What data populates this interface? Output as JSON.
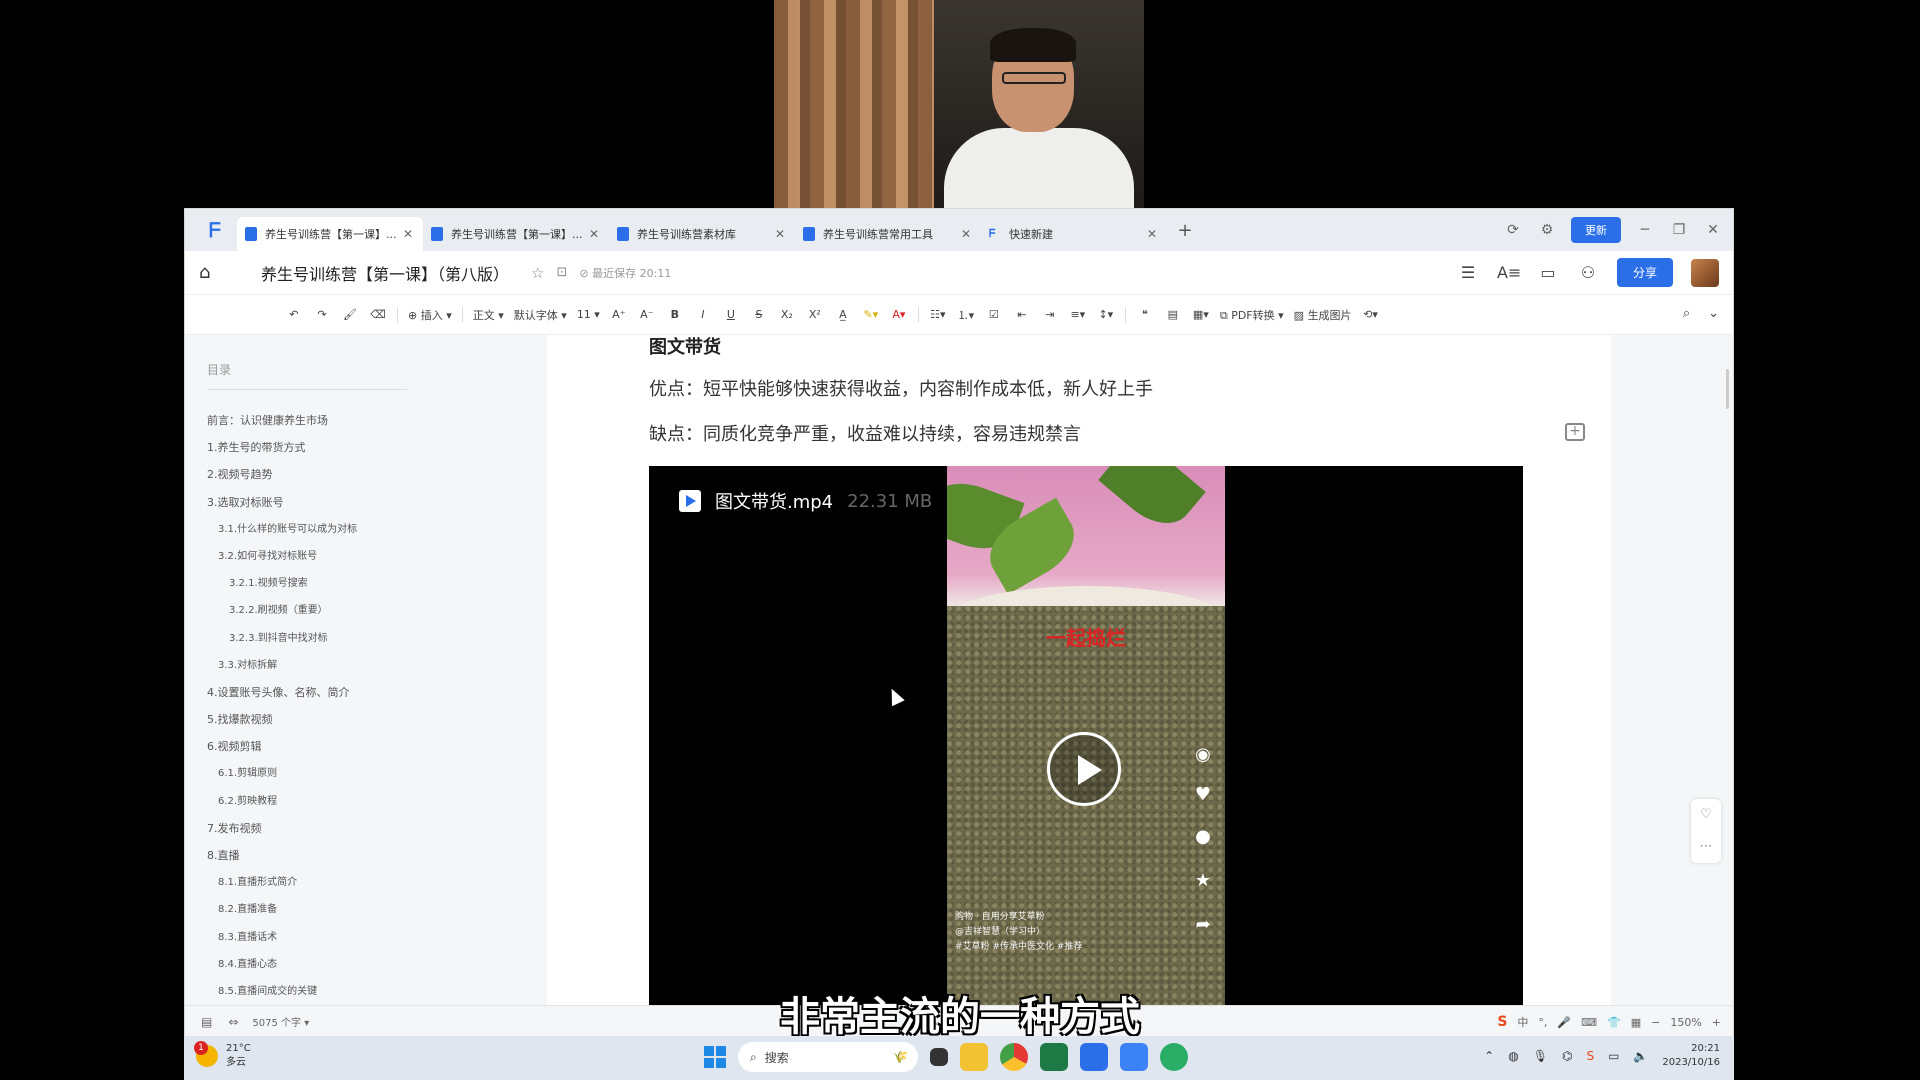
{
  "tabs": [
    {
      "label": "养生号训练营【第一课】...",
      "active": true
    },
    {
      "label": "养生号训练营【第一课】...",
      "active": false
    },
    {
      "label": "养生号训练营素材库",
      "active": false
    },
    {
      "label": "养生号训练营常用工具",
      "active": false
    },
    {
      "label": "快速新建",
      "active": false
    }
  ],
  "window": {
    "update_label": "更新"
  },
  "docbar": {
    "title": "养生号训练营【第一课】（第八版）",
    "save_status": "最近保存 20:11",
    "share_label": "分享"
  },
  "toolbar": {
    "insert": "插入",
    "style": "正文",
    "font": "默认字体",
    "size": "11",
    "pdf": "PDF转换",
    "gen_image": "生成图片"
  },
  "outline": {
    "title": "目录",
    "items": [
      {
        "label": "前言：认识健康养生市场",
        "level": 1
      },
      {
        "label": "1.养生号的带货方式",
        "level": 1
      },
      {
        "label": "2.视频号趋势",
        "level": 1
      },
      {
        "label": "3.选取对标账号",
        "level": 1
      },
      {
        "label": "3.1.什么样的账号可以成为对标",
        "level": 2
      },
      {
        "label": "3.2.如何寻找对标账号",
        "level": 2
      },
      {
        "label": "3.2.1.视频号搜索",
        "level": 3
      },
      {
        "label": "3.2.2.刷视频（重要）",
        "level": 3
      },
      {
        "label": "3.2.3.到抖音中找对标",
        "level": 3
      },
      {
        "label": "3.3.对标拆解",
        "level": 2
      },
      {
        "label": "4.设置账号头像、名称、简介",
        "level": 1
      },
      {
        "label": "5.找爆款视频",
        "level": 1
      },
      {
        "label": "6.视频剪辑",
        "level": 1
      },
      {
        "label": "6.1.剪辑原则",
        "level": 2
      },
      {
        "label": "6.2.剪映教程",
        "level": 2
      },
      {
        "label": "7.发布视频",
        "level": 1
      },
      {
        "label": "8.直播",
        "level": 1
      },
      {
        "label": "8.1.直播形式简介",
        "level": 2
      },
      {
        "label": "8.2.直播准备",
        "level": 2
      },
      {
        "label": "8.3.直播话术",
        "level": 2
      },
      {
        "label": "8.4.直播心态",
        "level": 2
      },
      {
        "label": "8.5.直播间成交的关键",
        "level": 2
      }
    ]
  },
  "doc": {
    "heading": "图文带货",
    "pros": "优点：短平快能够快速获得收益，内容制作成本低，新人好上手",
    "cons": "缺点：同质化竞争严重，收益难以持续，容易违规禁言"
  },
  "video": {
    "filename": "图文带货.mp4",
    "size": "22.31 MB",
    "frame_caption": "一起捣烂",
    "frame_info": [
      "购物 · 自用分享艾草粉",
      "@吉祥智慧（学习中）",
      "#艾草粉 #传承中医文化 #推荐"
    ]
  },
  "statusbar": {
    "word_count": "5075 个字",
    "ime": "S",
    "ime_mode": "中",
    "zoom": "150%"
  },
  "subtitle": "非常主流的一种方式",
  "taskbar": {
    "temperature": "21°C",
    "weather": "多云",
    "weather_badge": "1",
    "search_placeholder": "搜索",
    "time": "20:21",
    "date": "2023/10/16"
  },
  "colors": {
    "accent": "#2b6fe8",
    "subtitle": "#ffffff"
  }
}
